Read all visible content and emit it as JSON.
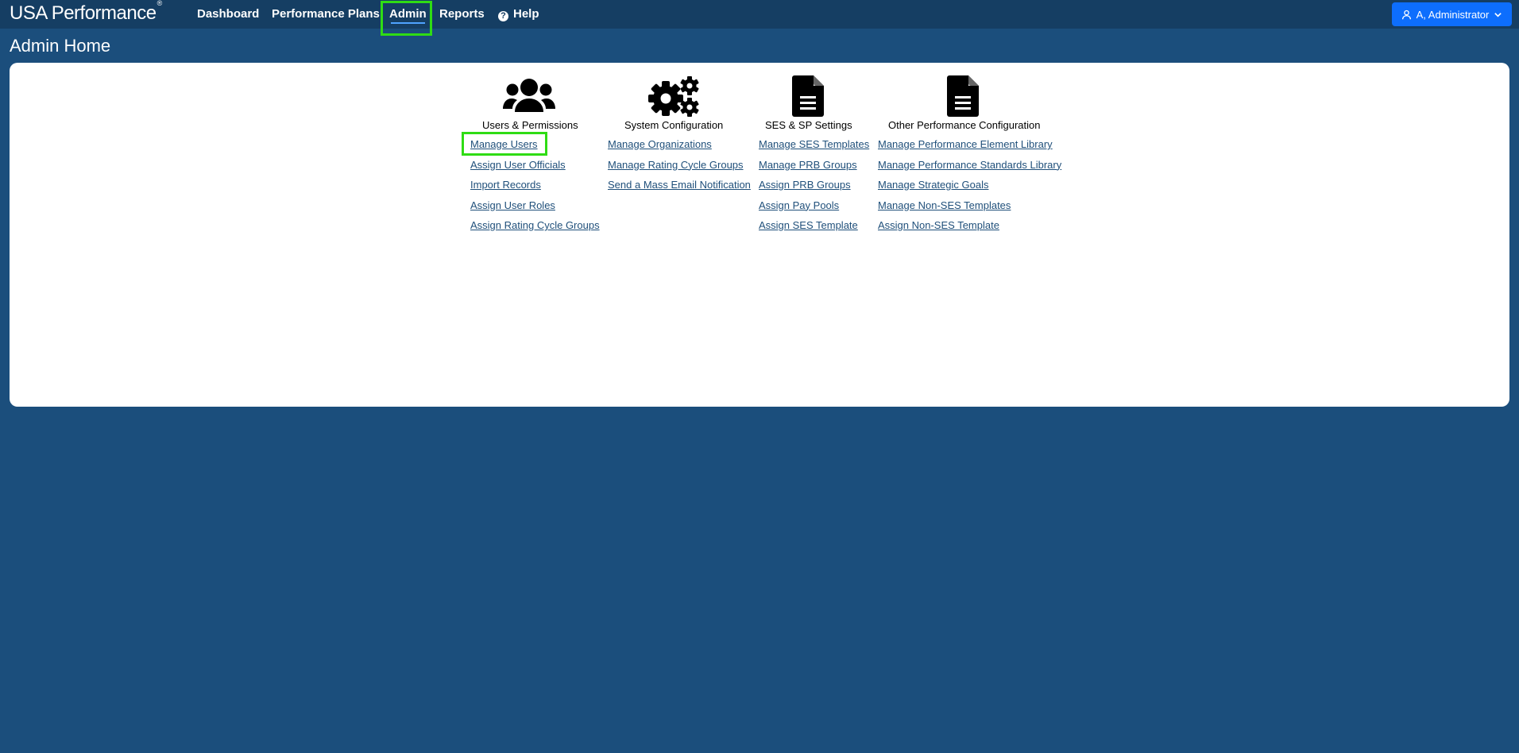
{
  "app": {
    "title": "USA Performance",
    "title_mark": "®"
  },
  "nav": {
    "items": [
      {
        "label": "Dashboard"
      },
      {
        "label": "Performance Plans"
      },
      {
        "label": "Admin"
      },
      {
        "label": "Reports"
      },
      {
        "label": "Help"
      }
    ],
    "active": "Admin"
  },
  "user": {
    "label": "A, Administrator"
  },
  "page": {
    "title": "Admin Home"
  },
  "sections": [
    {
      "heading": "Users & Permissions",
      "icon": "users-icon",
      "links": [
        "Manage Users",
        "Assign User Officials",
        "Import Records",
        "Assign User Roles",
        "Assign Rating Cycle Groups"
      ]
    },
    {
      "heading": "System Configuration",
      "icon": "gears-icon",
      "links": [
        "Manage Organizations",
        "Manage Rating Cycle Groups",
        "Send a Mass Email Notification"
      ]
    },
    {
      "heading": "SES & SP Settings",
      "icon": "document-icon",
      "links": [
        "Manage SES Templates",
        "Manage PRB Groups",
        "Assign PRB Groups",
        "Assign Pay Pools",
        "Assign SES Template"
      ]
    },
    {
      "heading": "Other Performance Configuration",
      "icon": "document-icon",
      "links": [
        "Manage Performance Element Library",
        "Manage Performance Standards Library",
        "Manage Strategic Goals",
        "Manage Non-SES Templates",
        "Assign Non-SES Template"
      ]
    }
  ],
  "colors": {
    "background": "#1b4e7c",
    "topbar": "#153e63",
    "highlight": "#2fdc14",
    "user_button": "#0d6efd",
    "link": "#1f4f7a"
  }
}
